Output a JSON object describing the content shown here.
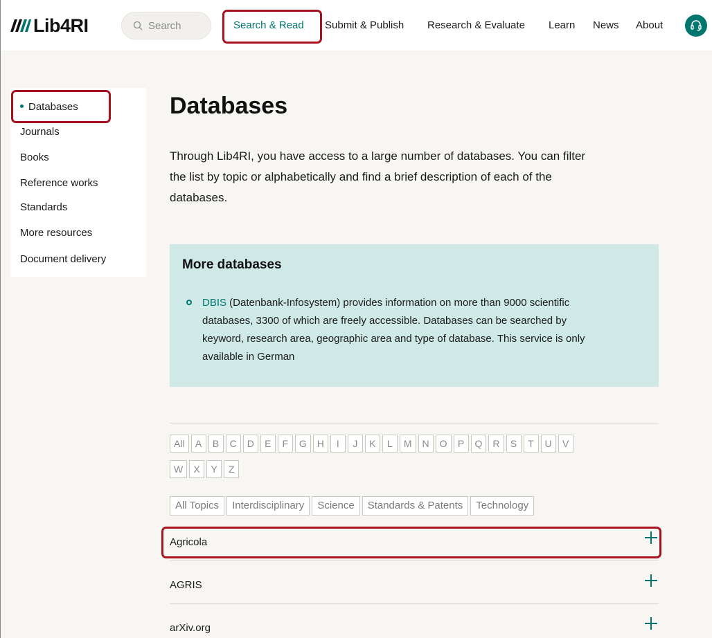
{
  "brand": {
    "name": "Lib4RI"
  },
  "header": {
    "search_placeholder": "Search",
    "nav": [
      {
        "label": "Search & Read",
        "active": true
      },
      {
        "label": "Submit & Publish"
      },
      {
        "label": "Research & Evaluate"
      },
      {
        "label": "Learn"
      },
      {
        "label": "News"
      },
      {
        "label": "About"
      }
    ],
    "help_icon": "headset-icon"
  },
  "sidebar": {
    "items": [
      {
        "label": "Databases",
        "active": true
      },
      {
        "label": "Journals"
      },
      {
        "label": "Books"
      },
      {
        "label": "Reference works"
      },
      {
        "label": "Standards"
      },
      {
        "label": "More resources"
      },
      {
        "label": "Document delivery"
      }
    ]
  },
  "main": {
    "title": "Databases",
    "intro_lines": [
      "Through Lib4RI, you have access to a large number of databases. You can filter",
      "the list by topic or alphabetically and find a brief description of each of the",
      "databases."
    ],
    "more": {
      "title": "More databases",
      "link_text": "DBIS",
      "text_lines": [
        " (Datenbank-Infosystem) provides information on more than 9000 scientific",
        "databases, 3300 of which are freely accessible. Databases can be searched by",
        "keyword, research area, geographic area and type of database. This service is only",
        "available in German"
      ]
    },
    "alphabet_row1": [
      "All",
      "A",
      "B",
      "C",
      "D",
      "E",
      "F",
      "G",
      "H",
      "I",
      "J",
      "K",
      "L",
      "M",
      "N",
      "O",
      "P",
      "Q",
      "R",
      "S",
      "T",
      "U",
      "V"
    ],
    "alphabet_row2": [
      "W",
      "X",
      "Y",
      "Z"
    ],
    "topics": [
      "All Topics",
      "Interdisciplinary",
      "Science",
      "Standards & Patents",
      "Technology"
    ],
    "databases": [
      "Agricola",
      "AGRIS",
      "arXiv.org"
    ]
  },
  "colors": {
    "accent": "#00766f",
    "highlight": "#a6121d",
    "info_box": "#cfe9e6"
  }
}
